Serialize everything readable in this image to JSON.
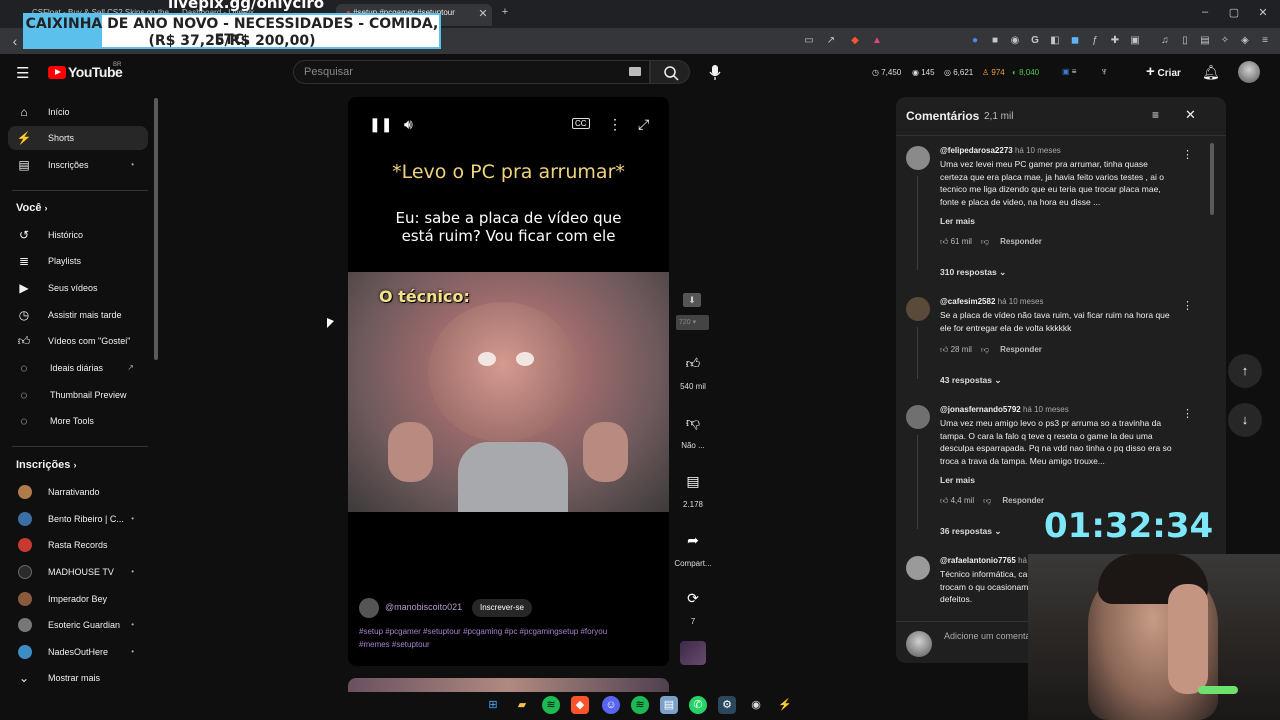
{
  "browser": {
    "tabs": [
      {
        "label": "CSFloat - Buy & Sell CS2 Skins on the"
      },
      {
        "label": "Dashboard - LivePix"
      },
      {
        "label": "#setup #pcgamer #setuptour"
      }
    ],
    "new_tab": "+",
    "window_controls": [
      "–",
      "▢",
      "✕"
    ]
  },
  "overlay": {
    "livepix_url": "livepix.gg/onlyciro",
    "goal_line1": "CAIXINHA DE ANO NOVO - NECESSIDADES - COMIDA, ETC.",
    "goal_line2": "(R$ 37,25/R$ 200,00)",
    "goal_progress": 0.186,
    "timer": "01:32:34"
  },
  "youtube": {
    "logo_text": "YouTube",
    "logo_region": "BR",
    "search_placeholder": "Pesquisar",
    "header_stats": {
      "views": "7,450",
      "a": "145",
      "b": "6,621",
      "c": "974",
      "d": "8,040"
    },
    "create_label": "Criar"
  },
  "sidebar": {
    "main": [
      {
        "label": "Início",
        "icon": "home-icon"
      },
      {
        "label": "Shorts",
        "icon": "shorts-icon",
        "selected": true
      },
      {
        "label": "Inscrições",
        "icon": "subscriptions-icon"
      }
    ],
    "you_heading": "Você",
    "you": [
      {
        "label": "Histórico",
        "icon": "history-icon"
      },
      {
        "label": "Playlists",
        "icon": "playlists-icon"
      },
      {
        "label": "Seus vídeos",
        "icon": "your-videos-icon"
      },
      {
        "label": "Assistir mais tarde",
        "icon": "watch-later-icon"
      },
      {
        "label": "Vídeos com \"Gostei\"",
        "icon": "liked-icon"
      },
      {
        "label": "Ideais diárias",
        "icon": "ideas-icon"
      },
      {
        "label": "Thumbnail Preview",
        "icon": "thumbnail-icon"
      },
      {
        "label": "More Tools",
        "icon": "tools-icon"
      }
    ],
    "subs_heading": "Inscrições",
    "subscriptions": [
      {
        "label": "Narrativando",
        "color": "#b07a4a"
      },
      {
        "label": "Bento Ribeiro | C...",
        "color": "#3a6ea5"
      },
      {
        "label": "Rasta Records",
        "color": "#c63a2f"
      },
      {
        "label": "MADHOUSE TV",
        "color": "#2b2b2b"
      },
      {
        "label": "Imperador Bey",
        "color": "#8a5a3c"
      },
      {
        "label": "Esoteric Guardian",
        "color": "#777777"
      },
      {
        "label": "NadesOutHere",
        "color": "#3d8cc4"
      }
    ],
    "show_more": "Mostrar mais"
  },
  "short": {
    "title": "*Levo o PC pra arrumar*",
    "caption_line1": "Eu: sabe a placa de vídeo que",
    "caption_line2": "está ruim? Vou ficar com ele",
    "meme_label": "O técnico:",
    "channel": "@manobiscoito021",
    "subscribe": "Inscrever-se",
    "tags_line1": "#setup #pcgamer #setuptour #pcgaming #pc #pcgamingsetup #foryou",
    "tags_line2": "#memes #setuptour",
    "quality": "720",
    "likes": "540 mil",
    "dislike_label": "Não ...",
    "comments_count": "2.178",
    "share_label": "Compart...",
    "remix_count": "7"
  },
  "comments_panel": {
    "title": "Comentários",
    "count": "2,1 mil",
    "add_placeholder": "Adicione um comentário...",
    "items": [
      {
        "user": "@felipedarosa2273",
        "time": "há 10 meses",
        "text": "Uma vez levei meu PC gamer pra arrumar, tinha quase certeza que era placa mae, ja havia feito varios testes , ai o tecnico me liga dizendo que eu teria que trocar placa mae, fonte e placa de video, na hora eu disse ...",
        "more": "Ler mais",
        "likes": "61 mil",
        "reply": "Responder",
        "replies": "310 respostas"
      },
      {
        "user": "@cafesim2582",
        "time": "há 10 meses",
        "text": "Se a placa de vídeo não tava ruim, vai ficar ruim na hora que ele for entregar ela de volta kkkkkk",
        "likes": "28 mil",
        "reply": "Responder",
        "replies": "43 respostas"
      },
      {
        "user": "@jonasfernando5792",
        "time": "há 10 meses",
        "text": "Uma vez meu amigo levo o ps3 pr arruma so a travinha da tampa. O cara la falo q teve q reseta o game la deu uma desculpa esparrapada. Pq na vdd nao tinha o pq disso era so troca a trava da tampa. Meu amigo trouxe...",
        "more": "Ler mais",
        "likes": "4,4 mil",
        "reply": "Responder",
        "replies": "36 respostas"
      },
      {
        "user": "@rafaelantonio7765",
        "time": "há",
        "text": "Técnico informática, caras só trocam o qu ocasionam defeitos."
      }
    ]
  },
  "colors": {
    "accent_red": "#ff0000",
    "timer": "#7ee8fa",
    "tags": "#a782d0"
  }
}
